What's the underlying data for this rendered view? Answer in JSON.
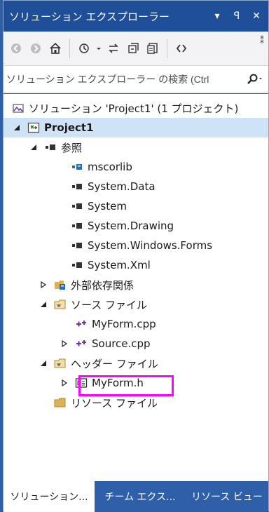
{
  "window": {
    "title": "ソリューション エクスプローラー",
    "pin_glyph": "ꟼ",
    "close_glyph": "✕"
  },
  "toolbar": {
    "overflow_glyph": "⁑"
  },
  "search": {
    "placeholder": "ソリューション エクスプローラー の検索 (Ctrl"
  },
  "tree": {
    "solution": "ソリューション 'Project1' (1 プロジェクト)",
    "project": "Project1",
    "references": "参照",
    "ref_items": [
      "mscorlib",
      "System.Data",
      "System",
      "System.Drawing",
      "System.Windows.Forms",
      "System.Xml"
    ],
    "external_deps": "外部依存関係",
    "source_files": "ソース ファイル",
    "source_items": [
      "MyForm.cpp",
      "Source.cpp"
    ],
    "header_files": "ヘッダー ファイル",
    "header_items": [
      "MyForm.h"
    ],
    "resource_files": "リソース ファイル"
  },
  "tabs": [
    {
      "label": "ソリューション..."
    },
    {
      "label": "チーム エクス..."
    },
    {
      "label": "リソース ビュー"
    }
  ],
  "colors": {
    "frame": "#2f5fa8",
    "highlight": "#ff00ff",
    "folder": "#d9b25a"
  }
}
